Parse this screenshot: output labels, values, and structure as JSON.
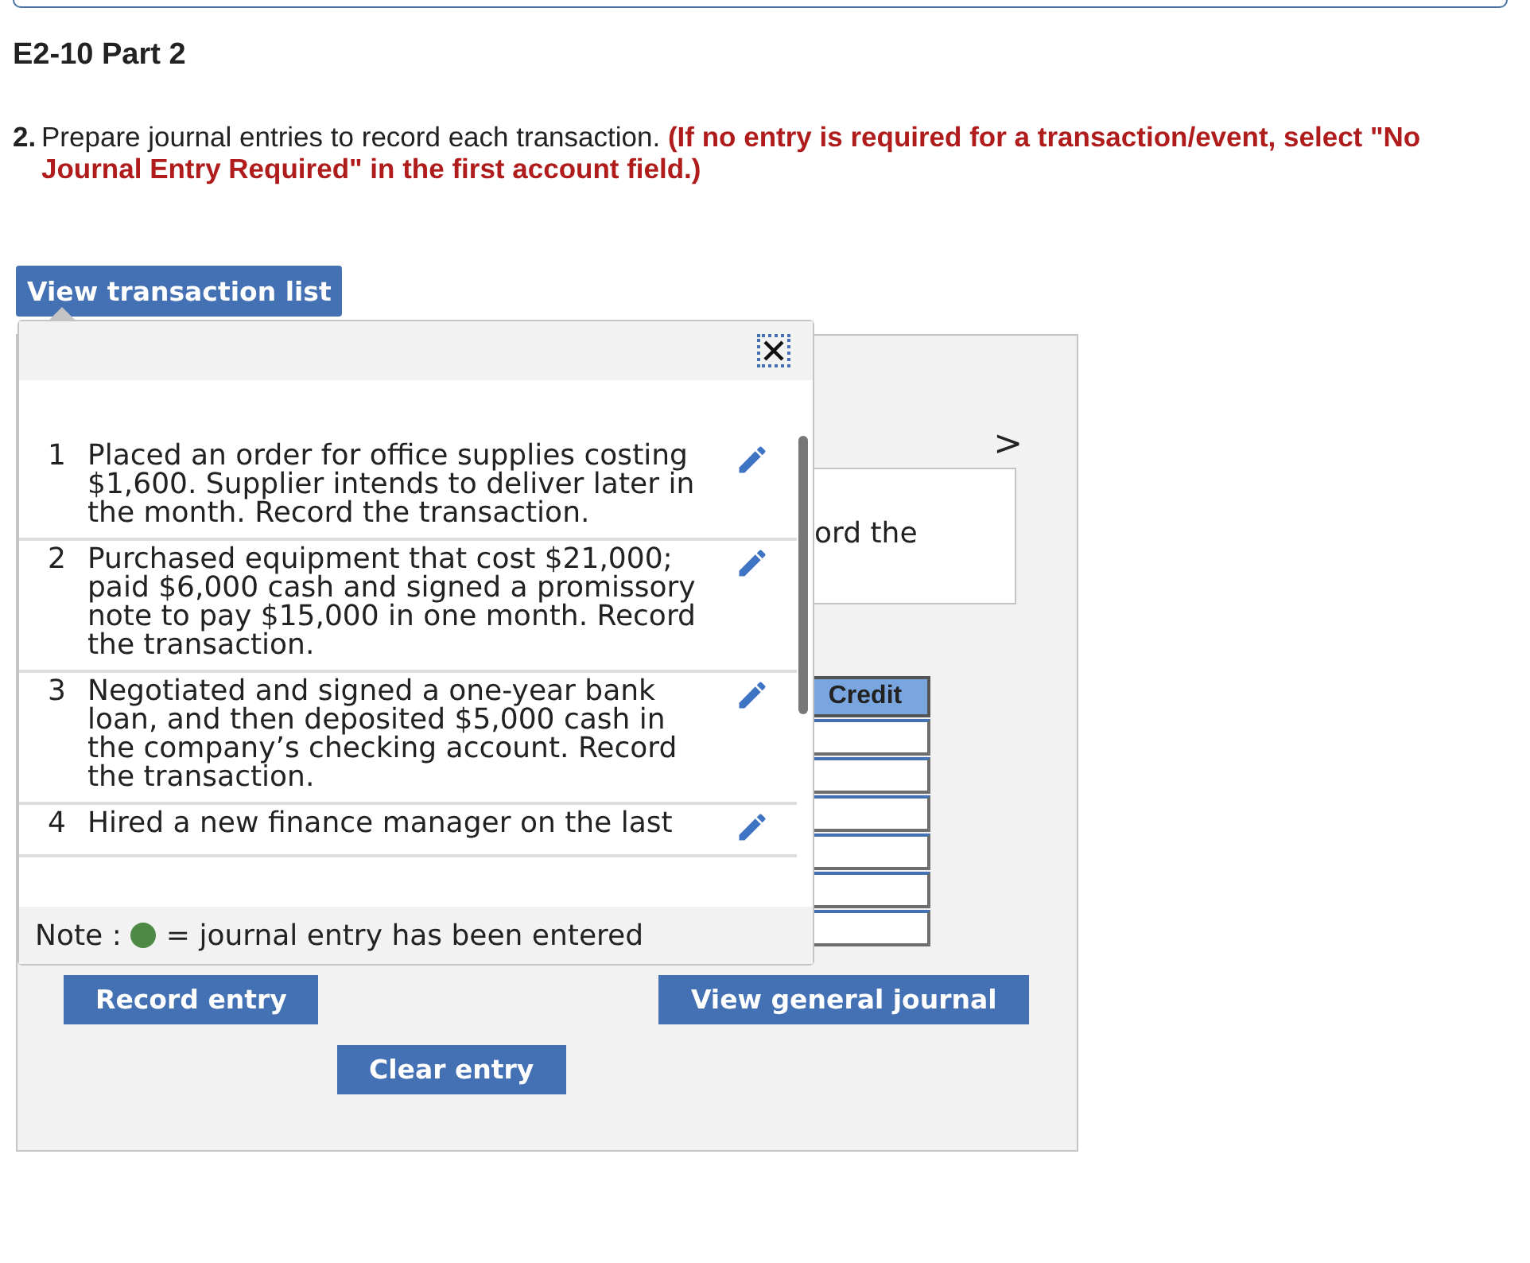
{
  "title": "E2-10 Part 2",
  "instruction": {
    "number": "2.",
    "text": "Prepare journal entries to record each transaction.",
    "note": "(If no entry is required for a transaction/event, select \"No Journal Entry Required\" in the first account field.)"
  },
  "view_list_button": "View transaction list",
  "transactions": [
    {
      "number": "1",
      "text": "Placed an order for office supplies costing $1,600. Supplier intends to deliver later in the month. Record the transaction."
    },
    {
      "number": "2",
      "text": "Purchased equipment that cost $21,000; paid $6,000 cash and signed a promissory note to pay $15,000 in one month. Record the transaction."
    },
    {
      "number": "3",
      "text": "Negotiated and signed a one-year bank loan, and then deposited $5,000 cash in the company’s checking account. Record the transaction."
    },
    {
      "number": "4",
      "text": "Hired a new finance manager on the last"
    }
  ],
  "legend": {
    "label": "Note :",
    "text": "= journal entry has been entered"
  },
  "next_arrow": ">",
  "transaction_text": "ord the",
  "table": {
    "columns": [
      "Credit"
    ],
    "rows": [
      {
        "kind": "input"
      },
      {
        "kind": "input"
      },
      {
        "kind": "input"
      },
      {
        "kind": "input"
      },
      {
        "kind": "input"
      },
      {
        "kind": "input"
      }
    ]
  },
  "buttons": {
    "record": "Record entry",
    "view_journal": "View general journal",
    "clear": "Clear entry"
  }
}
